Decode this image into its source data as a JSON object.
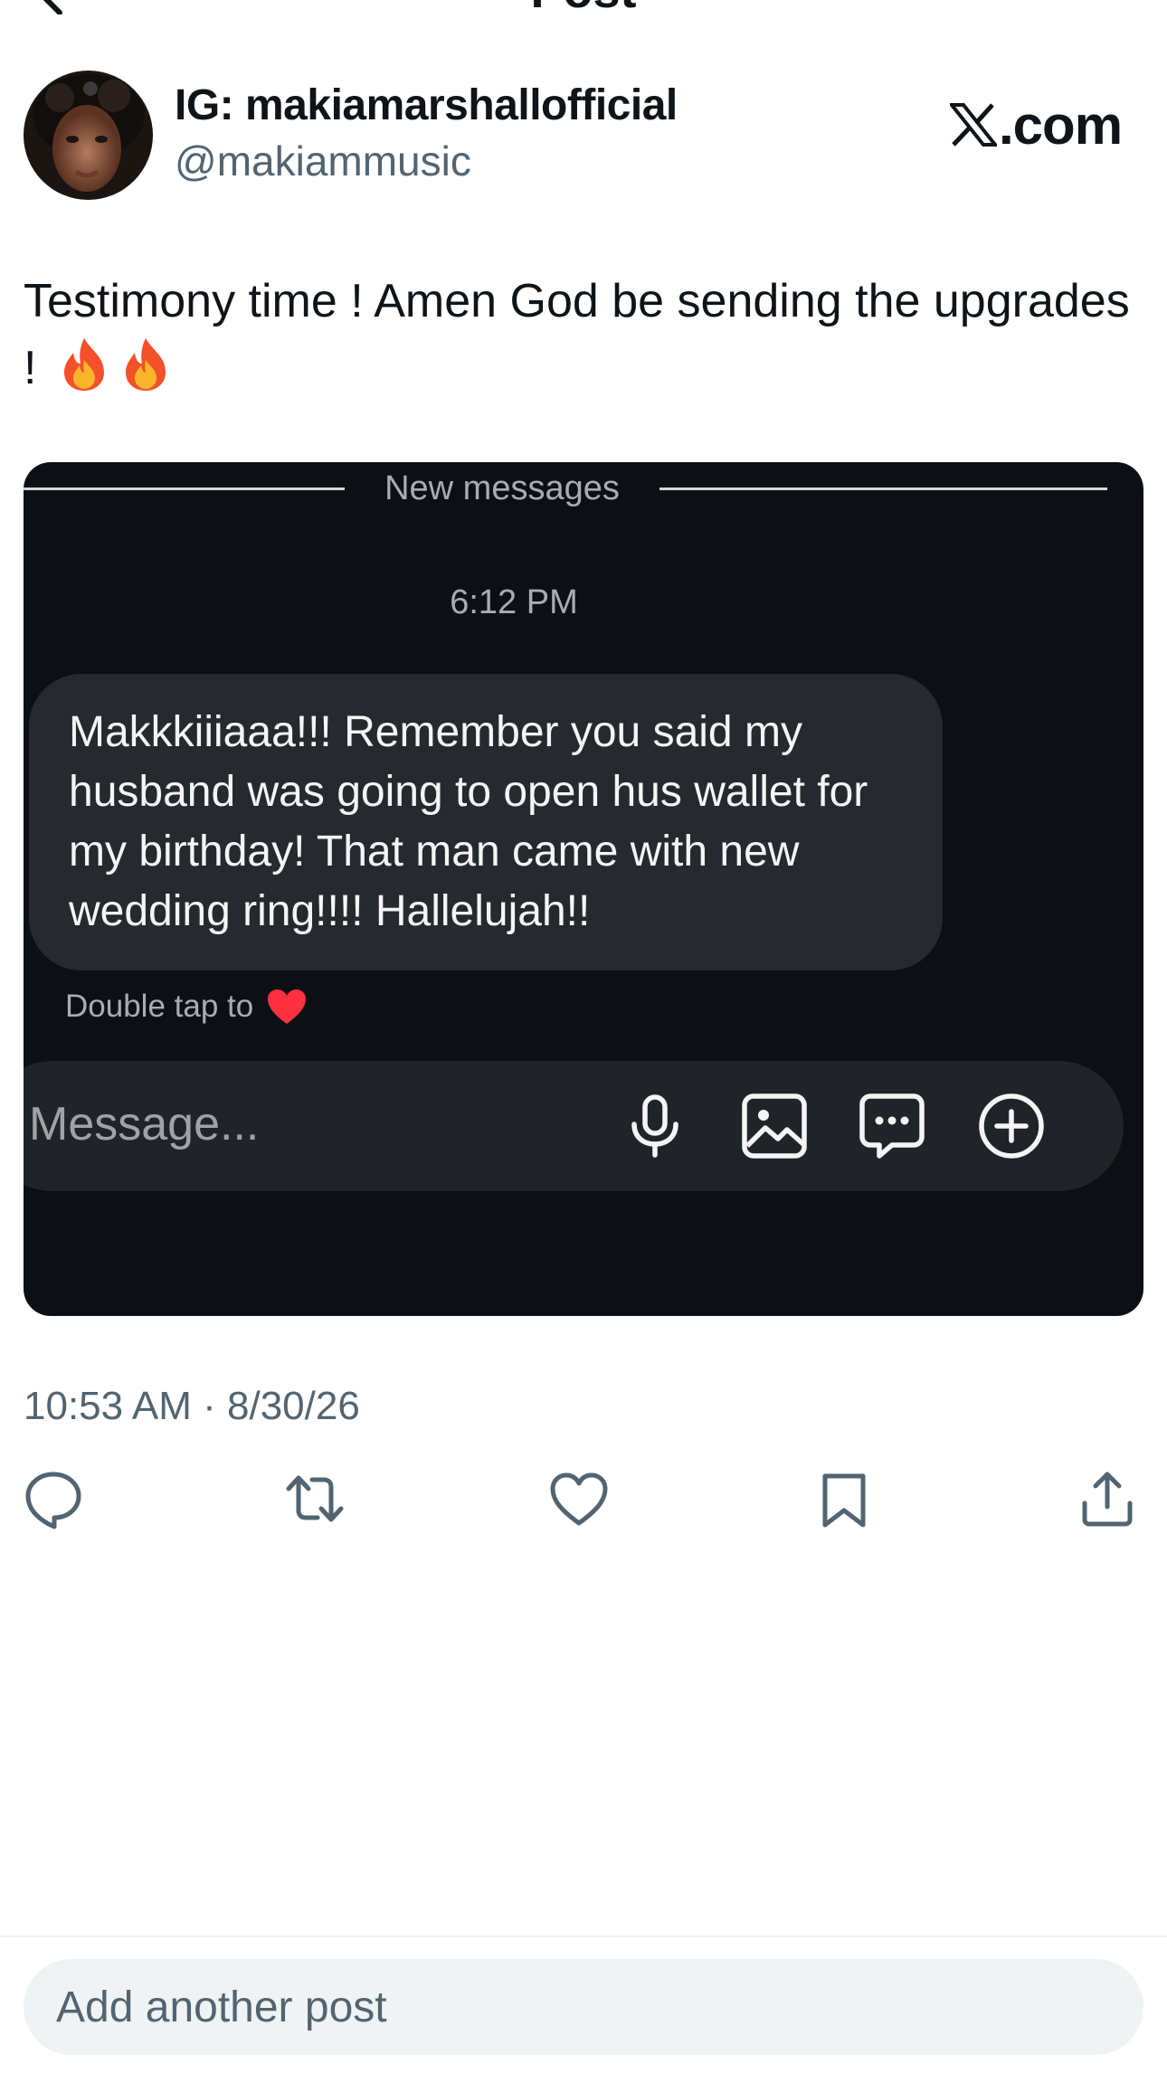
{
  "header": {
    "title": "Post"
  },
  "author": {
    "display_name": "IG: makiamarshallofficial",
    "handle": "@makiammusic"
  },
  "watermark": {
    "text": ".com",
    "logo_icon": "x-logo-icon"
  },
  "post": {
    "text": "Testimony time ! Amen God be sending the upgrades ! ",
    "emoji": [
      "fire",
      "fire"
    ]
  },
  "media": {
    "divider_label": "New messages",
    "message_time": "6:12 PM",
    "message_text": "Makkkiiiaaa!!!  Remember you said my husband was going to open hus wallet for my birthday!  That man came with new wedding ring!!!! Hallelujah!!",
    "reaction_hint": "Double tap to",
    "reaction_icon": "heart-icon",
    "composer_placeholder": "Message...",
    "composer_icons": [
      "microphone-icon",
      "gallery-icon",
      "sticker-icon",
      "plus-circle-icon"
    ]
  },
  "timestamp": "10:53 AM · 8/30/26",
  "actions": [
    "reply-icon",
    "repost-icon",
    "like-icon",
    "bookmark-icon",
    "share-icon"
  ],
  "reply_bar": {
    "placeholder": "Add another post"
  },
  "colors": {
    "text": "#0f1419",
    "secondary_text": "#536471",
    "media_bg": "#0c1014",
    "bubble_bg": "#262a2f",
    "heart": "#ff3040",
    "reply_bg": "#eff3f4"
  }
}
